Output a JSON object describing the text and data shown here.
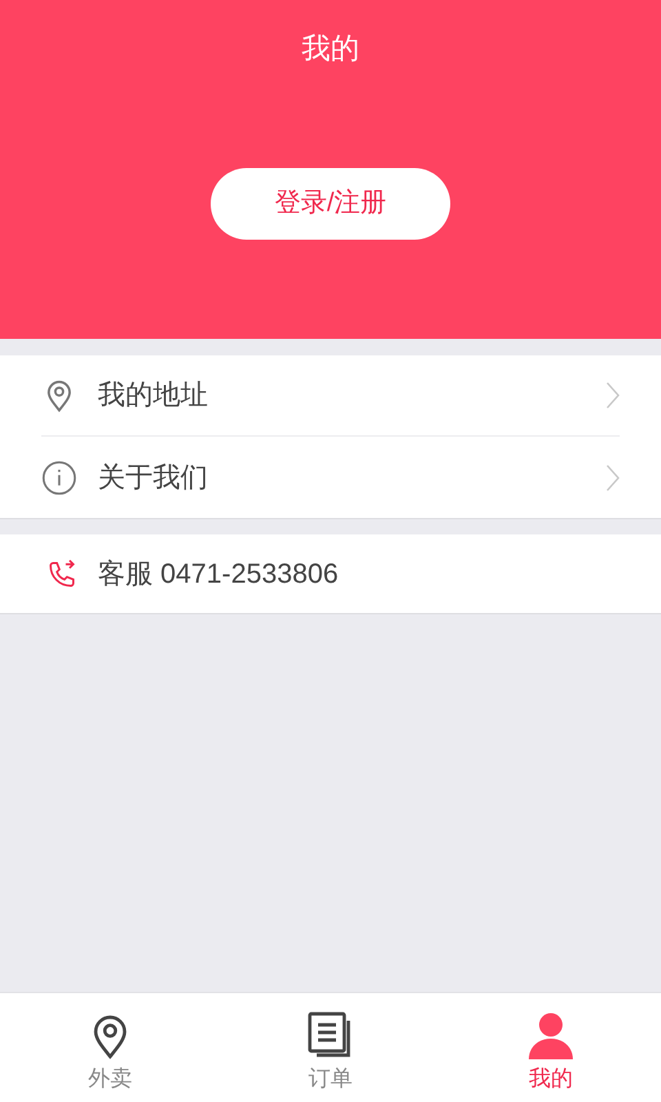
{
  "header": {
    "title": "我的",
    "login_button": "登录/注册"
  },
  "menu": [
    {
      "kind": "location",
      "label": "我的地址"
    },
    {
      "kind": "info",
      "label": "关于我们"
    }
  ],
  "service": {
    "label": "客服 0471-2533806"
  },
  "tab_bar": [
    {
      "kind": "location",
      "label": "外卖",
      "selected": false
    },
    {
      "kind": "orders",
      "label": "订单",
      "selected": false
    },
    {
      "kind": "person",
      "label": "我的",
      "selected": true
    }
  ]
}
